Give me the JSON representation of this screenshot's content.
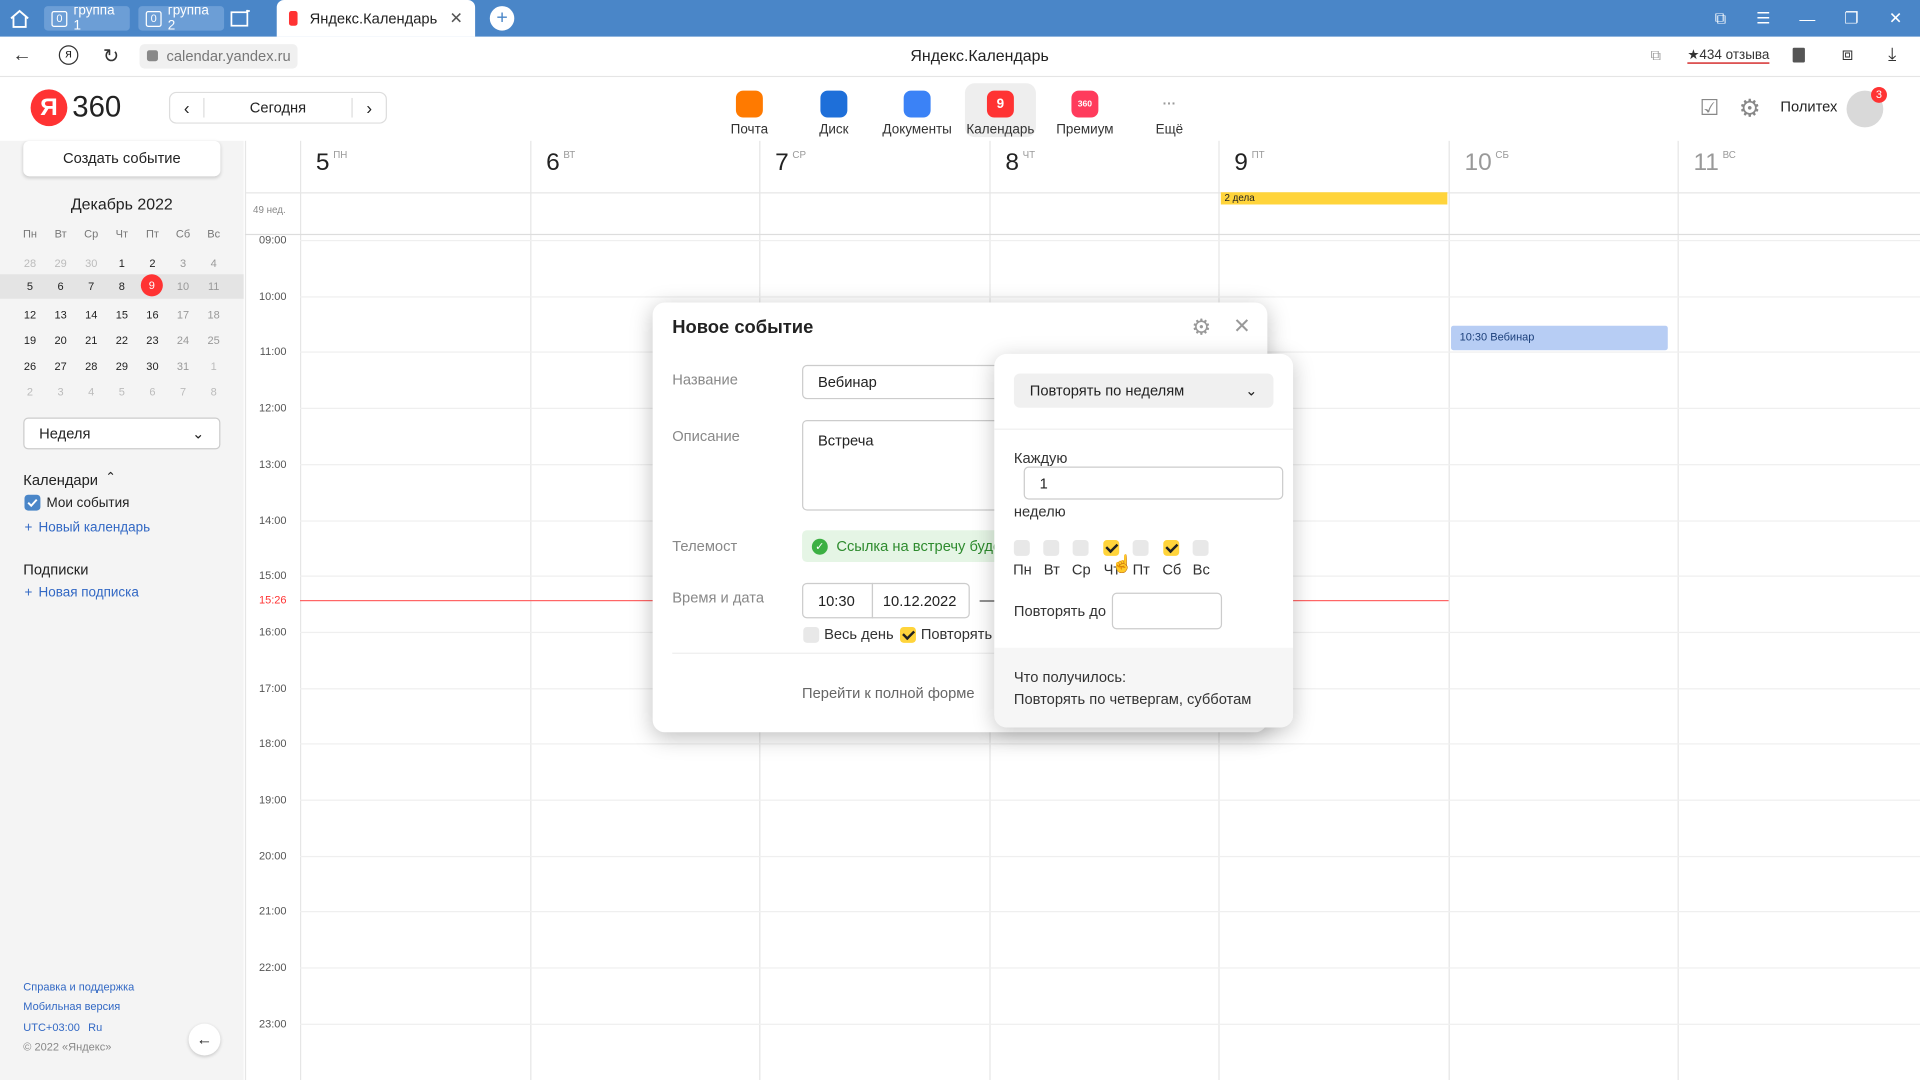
{
  "browser": {
    "group1": {
      "count": "0",
      "label": "группа 1"
    },
    "group2": {
      "count": "0",
      "label": "группа 2"
    },
    "tab_title": "Яндекс.Календарь",
    "url": "calendar.yandex.ru",
    "page_title": "Яндекс.Календарь",
    "reviews": "★434 отзыва"
  },
  "header": {
    "logo_letter": "Я",
    "logo_text": "360",
    "today_button": "Сегодня",
    "services": [
      {
        "label": "Почта",
        "icon": "mail-icon",
        "color": "#ff7a00",
        "badge": ""
      },
      {
        "label": "Диск",
        "icon": "disk-icon",
        "color": "#1e6fd9",
        "badge": ""
      },
      {
        "label": "Документы",
        "icon": "docs-icon",
        "color": "#3b82f6",
        "badge": ""
      },
      {
        "label": "Календарь",
        "icon": "calendar-icon",
        "color": "#f33",
        "badge": "9"
      },
      {
        "label": "Премиум",
        "icon": "premium-icon",
        "color": "#ff3b5c",
        "badge": "360"
      },
      {
        "label": "Ещё",
        "icon": "more-icon",
        "color": "",
        "badge": "···"
      }
    ],
    "user_name": "Политех",
    "notif_count": "3"
  },
  "sidebar": {
    "create_button": "Создать событие",
    "month_title": "Декабрь 2022",
    "weekdays": [
      "Пн",
      "Вт",
      "Ср",
      "Чт",
      "Пт",
      "Сб",
      "Вс"
    ],
    "weeks": [
      [
        "28",
        "29",
        "30",
        "1",
        "2",
        "3",
        "4"
      ],
      [
        "5",
        "6",
        "7",
        "8",
        "9",
        "10",
        "11"
      ],
      [
        "12",
        "13",
        "14",
        "15",
        "16",
        "17",
        "18"
      ],
      [
        "19",
        "20",
        "21",
        "22",
        "23",
        "24",
        "25"
      ],
      [
        "26",
        "27",
        "28",
        "29",
        "30",
        "31",
        "1"
      ],
      [
        "2",
        "3",
        "4",
        "5",
        "6",
        "7",
        "8"
      ]
    ],
    "today": "9",
    "view_select": "Неделя",
    "calendars_title": "Календари",
    "my_events": "Мои события",
    "new_calendar": "Новый календарь",
    "subscriptions_title": "Подписки",
    "new_subscription": "Новая подписка",
    "footer": {
      "help": "Справка и поддержка",
      "mobile": "Мобильная версия",
      "timezone": "UTC+03:00",
      "lang": "Ru",
      "copyright": "© 2022 «Яндекс»"
    }
  },
  "week": {
    "week_label": "49 нед.",
    "days": [
      {
        "num": "5",
        "name": "пн"
      },
      {
        "num": "6",
        "name": "вт"
      },
      {
        "num": "7",
        "name": "ср"
      },
      {
        "num": "8",
        "name": "чт"
      },
      {
        "num": "9",
        "name": "пт"
      },
      {
        "num": "10",
        "name": "сб"
      },
      {
        "num": "11",
        "name": "вс"
      }
    ],
    "allday_badge": "2 дела",
    "times": [
      "09:00",
      "10:00",
      "11:00",
      "12:00",
      "13:00",
      "14:00",
      "15:00",
      "16:00",
      "17:00",
      "18:00",
      "19:00",
      "20:00",
      "21:00",
      "22:00",
      "23:00"
    ],
    "now_time": "15:26",
    "event": "10:30 Вебинар"
  },
  "modal": {
    "title": "Новое событие",
    "name_label": "Название",
    "name_value": "Вебинар",
    "desc_label": "Описание",
    "desc_value": "Встреча",
    "telemost_label": "Телемост",
    "telemost_text": "Ссылка на встречу будет в",
    "datetime_label": "Время и дата",
    "time_value": "10:30",
    "date_value": "10.12.2022",
    "dash": "—",
    "allday_label": "Весь день",
    "repeat_label": "Повторять",
    "full_form_link": "Перейти к полной форме"
  },
  "repeat": {
    "mode": "Повторять по неделям",
    "every_label": "Каждую",
    "every_value": "1",
    "unit": "неделю",
    "days": [
      {
        "label": "Пн",
        "checked": false
      },
      {
        "label": "Вт",
        "checked": false
      },
      {
        "label": "Ср",
        "checked": false
      },
      {
        "label": "Чт",
        "checked": true
      },
      {
        "label": "Пт",
        "checked": false
      },
      {
        "label": "Сб",
        "checked": true
      },
      {
        "label": "Вс",
        "checked": false
      }
    ],
    "until_label": "Повторять до",
    "until_value": "",
    "result_title": "Что получилось:",
    "result_text": "Повторять по четвергам, субботам"
  },
  "colors": {
    "accent": "#f33",
    "event_bg": "#b7cdf4",
    "highlight": "#ffd43b",
    "tabbar": "#4a86c8"
  }
}
